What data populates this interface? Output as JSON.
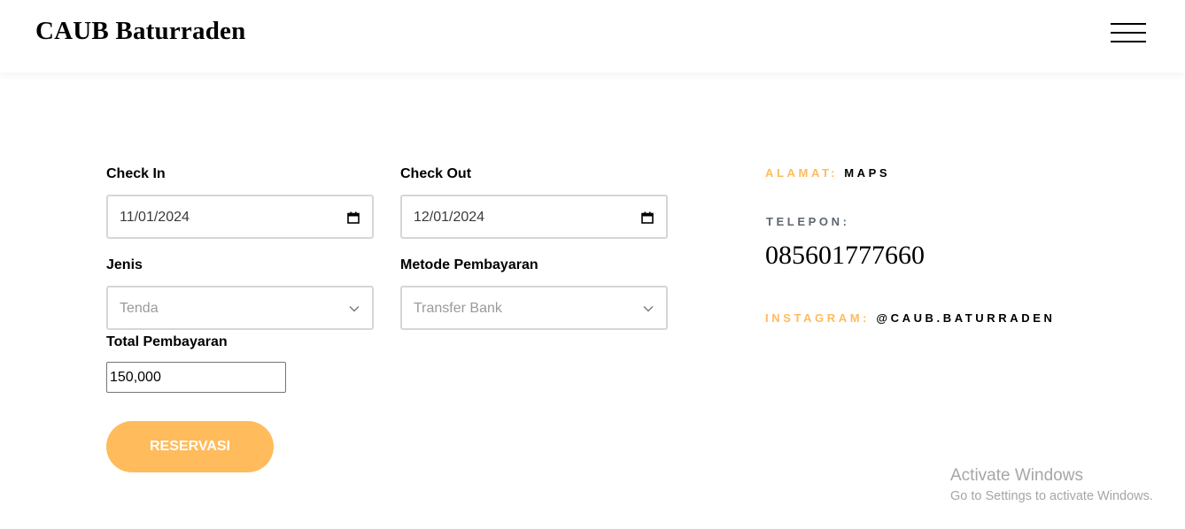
{
  "navbar": {
    "brand": "CAUB Baturraden",
    "menu_icon": "hamburger-menu-icon"
  },
  "form": {
    "check_in": {
      "label": "Check In",
      "value": "11/01/2024",
      "icon": "calendar-icon"
    },
    "check_out": {
      "label": "Check Out",
      "value": "12/01/2024",
      "icon": "calendar-icon"
    },
    "jenis": {
      "label": "Jenis",
      "selected": "Tenda",
      "icon": "chevron-down-icon"
    },
    "metode": {
      "label": "Metode Pembayaran",
      "selected": "Transfer Bank",
      "icon": "chevron-down-icon"
    },
    "total": {
      "label": "Total Pembayaran",
      "value": "150,000"
    },
    "submit_label": "RESERVASI"
  },
  "info": {
    "alamat_label": "ALAMAT:",
    "alamat_value": "MAPS",
    "telepon_label": "TELEPON:",
    "telepon_value": "085601777660",
    "instagram_label": "INSTAGRAM:",
    "instagram_value": "@CAUB.BATURRADEN"
  },
  "watermark": {
    "title": "Activate Windows",
    "subtitle": "Go to Settings to activate Windows."
  },
  "colors": {
    "accent": "#ffbb5c",
    "grey_label": "#5e6670",
    "field_border": "#d6d6d6"
  }
}
